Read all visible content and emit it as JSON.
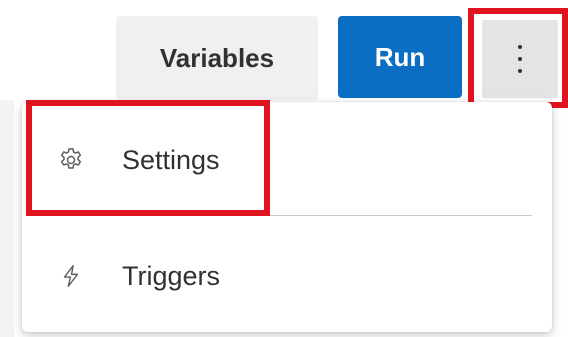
{
  "toolbar": {
    "variables_label": "Variables",
    "run_label": "Run",
    "more_icon": "more-vertical-icon"
  },
  "menu": {
    "items": [
      {
        "label": "Settings",
        "icon": "gear-icon"
      },
      {
        "label": "Triggers",
        "icon": "lightning-icon"
      }
    ]
  },
  "colors": {
    "run_button": "#0b6ec2",
    "highlight": "#e0141e",
    "secondary_button": "#f0f0f0"
  }
}
